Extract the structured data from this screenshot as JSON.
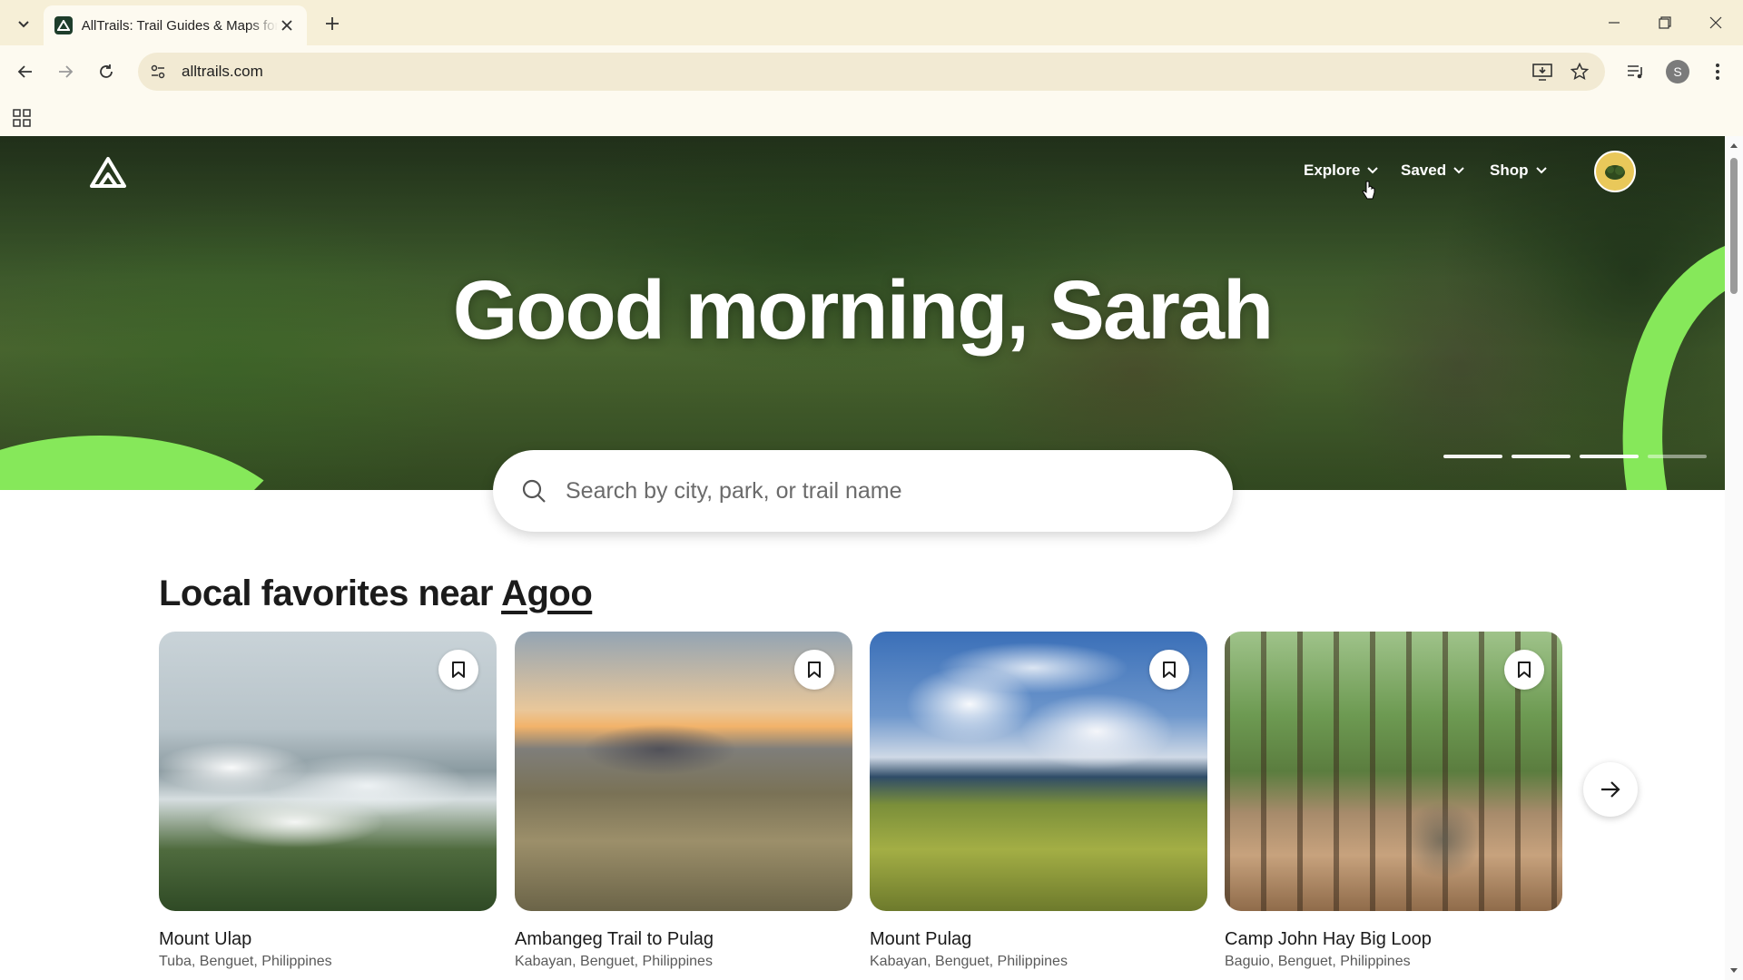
{
  "browser": {
    "tab_title": "AllTrails: Trail Guides & Maps for Hiking, Camping, and Running",
    "url": "alltrails.com",
    "profile_initial": "S"
  },
  "nav": {
    "explore": "Explore",
    "saved": "Saved",
    "shop": "Shop"
  },
  "hero": {
    "greeting": "Good morning, Sarah",
    "slides_total": 4,
    "slide_active": 3
  },
  "search": {
    "placeholder": "Search by city, park, or trail name"
  },
  "local": {
    "title_prefix": "Local favorites near ",
    "location": "Agoo"
  },
  "cards": [
    {
      "name": "Mount Ulap",
      "location": "Tuba, Benguet, Philippines"
    },
    {
      "name": "Ambangeg Trail to Pulag",
      "location": "Kabayan, Benguet, Philippines"
    },
    {
      "name": "Mount Pulag",
      "location": "Kabayan, Benguet, Philippines"
    },
    {
      "name": "Camp John Hay Big Loop",
      "location": "Baguio, Benguet, Philippines"
    }
  ],
  "colors": {
    "brand_green": "#86e85a",
    "chrome_bg": "#f6efd7",
    "dark_green": "#1e3d2b"
  }
}
